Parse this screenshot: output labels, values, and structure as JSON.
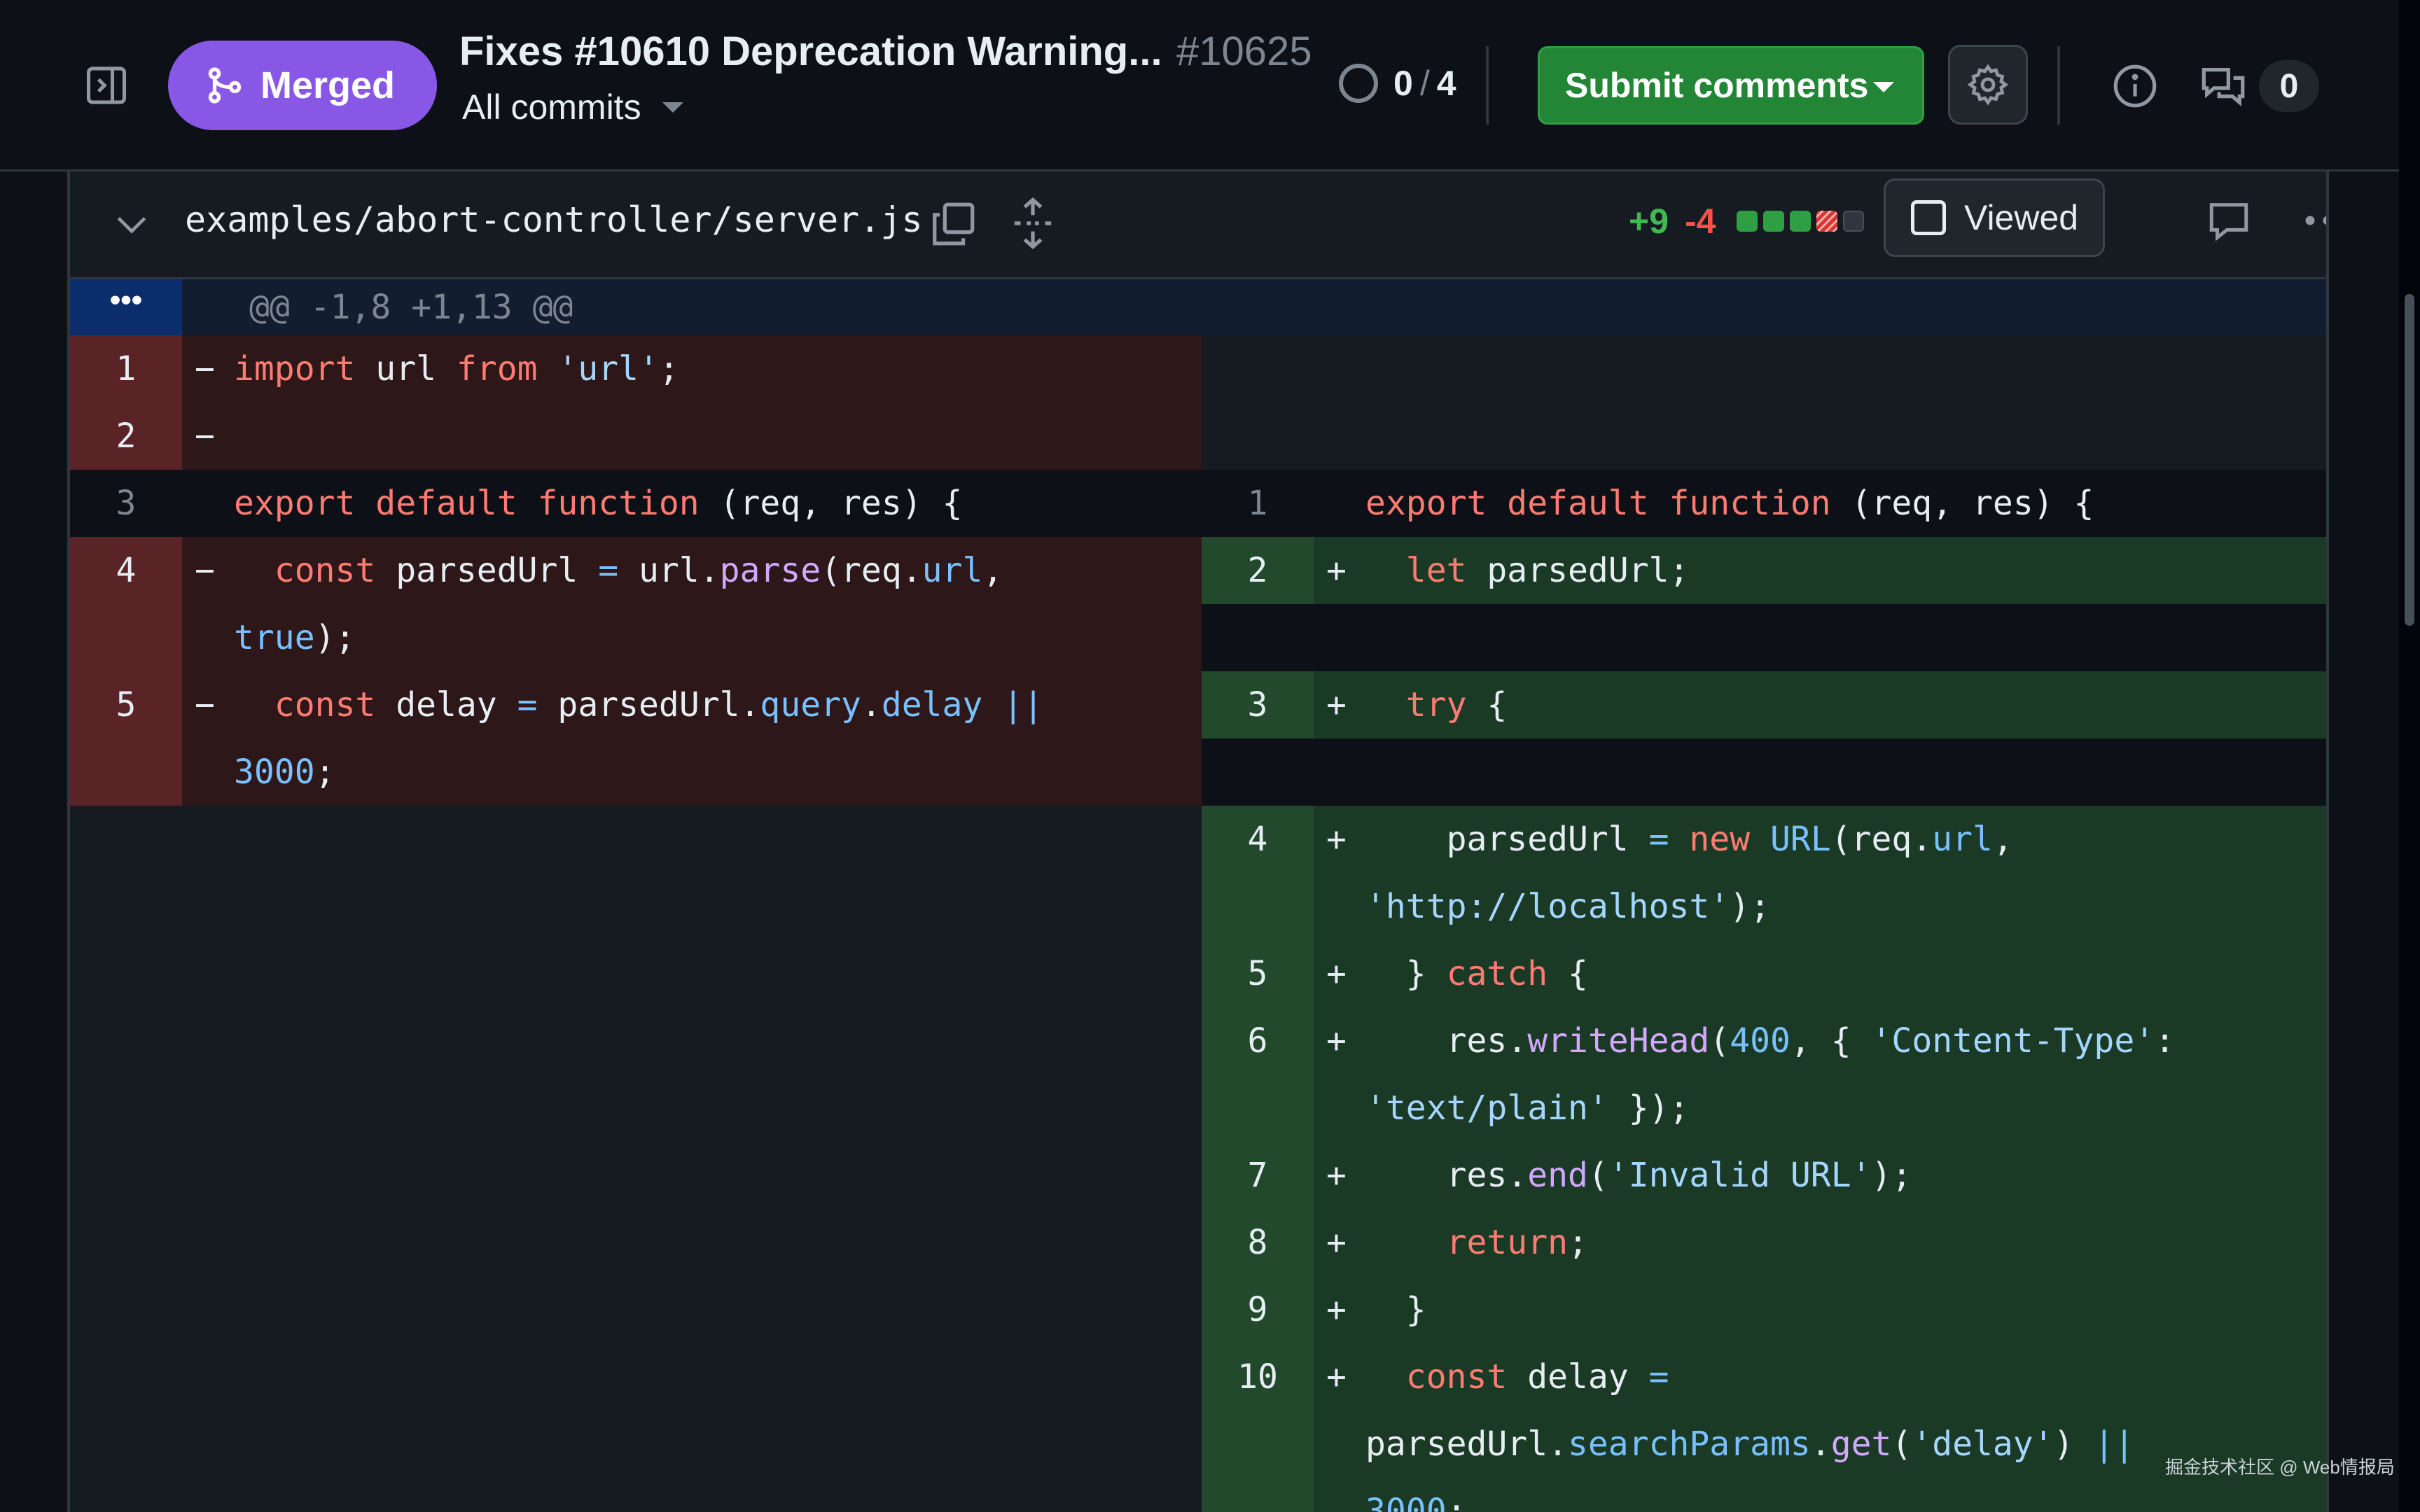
{
  "header": {
    "status_label": "Merged",
    "title": "Fixes #10610 Deprecation Warning...",
    "pr_number": "#10625",
    "commits_label": "All commits",
    "files_viewed": "0",
    "files_total": "4",
    "submit_label": "Submit comments",
    "comment_count": "0"
  },
  "file": {
    "path": "examples/abort-controller/server.js",
    "additions": "+9",
    "deletions": "-4",
    "diffstat": [
      "add",
      "add",
      "add",
      "del",
      "neutral"
    ],
    "viewed_label": "Viewed"
  },
  "diff": {
    "hunk_header": "@@ -1,8 +1,13 @@",
    "left": [
      {
        "num": "1",
        "marker": "−",
        "text": "import url from 'url';"
      },
      {
        "num": "2",
        "marker": "−",
        "text": ""
      },
      {
        "num": "3",
        "marker": "",
        "text": "export default function (req, res) {"
      },
      {
        "num": "4",
        "marker": "−",
        "text": "  const parsedUrl = url.parse(req.url,",
        "wrap": "true);"
      },
      {
        "num": "5",
        "marker": "−",
        "text": "  const delay = parsedUrl.query.delay ||",
        "wrap": "3000;"
      }
    ],
    "right": [
      {
        "num": "1",
        "marker": "",
        "text": "export default function (req, res) {"
      },
      {
        "num": "2",
        "marker": "+",
        "text": "  let parsedUrl;"
      },
      {
        "num": "3",
        "marker": "+",
        "text": "  try {"
      },
      {
        "num": "4",
        "marker": "+",
        "text": "    parsedUrl = new URL(req.url,",
        "wrap": "'http://localhost');"
      },
      {
        "num": "5",
        "marker": "+",
        "text": "  } catch {"
      },
      {
        "num": "6",
        "marker": "+",
        "text": "    res.writeHead(400, { 'Content-Type':",
        "wrap": "'text/plain' });"
      },
      {
        "num": "7",
        "marker": "+",
        "text": "    res.end('Invalid URL');"
      },
      {
        "num": "8",
        "marker": "+",
        "text": "    return;"
      },
      {
        "num": "9",
        "marker": "+",
        "text": "  }"
      },
      {
        "num": "10",
        "marker": "+",
        "text": "  const delay =",
        "wrap": "parsedUrl.searchParams.get('delay') ||",
        "wrap2": "3000;"
      }
    ]
  },
  "watermark": "掘金技术社区 @ Web情报局",
  "colors": {
    "merged": "#8957e5",
    "submit": "#238636",
    "addition_bg": "#1b3a25",
    "addition_gutter": "#23492d",
    "deletion_bg": "#2d1718",
    "deletion_gutter": "#5a2325",
    "hunk_bg": "#0c2d6b"
  }
}
